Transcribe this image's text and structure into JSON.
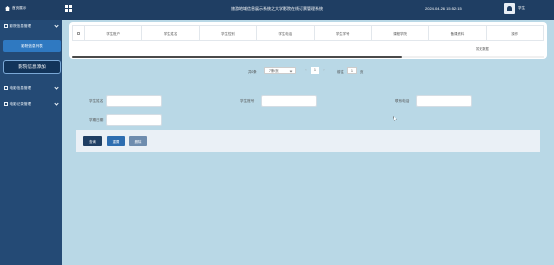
{
  "header": {
    "home_label": "首页展示",
    "title": "旅游地域信息展示系统之大学影院在线订票管理系统",
    "datetime": "2024.04.26 15:52:15",
    "username": "学生"
  },
  "sidebar": {
    "groups": [
      {
        "label": "影院信息管理",
        "expanded": true
      },
      {
        "label": "电影信息管理",
        "expanded": false
      },
      {
        "label": "电影记录管理",
        "expanded": false
      }
    ],
    "sub_items": [
      {
        "label": "影院信息列表"
      },
      {
        "label": "影院信息添加"
      }
    ]
  },
  "table": {
    "columns": [
      "学生账户",
      "学生姓名",
      "学生性别",
      "学生电话",
      "学生学号",
      "课程学院",
      "备课资料",
      "操作"
    ],
    "empty_text": "暂无数据"
  },
  "pagination": {
    "total_label": "共0条",
    "page_size": "7条/页",
    "prev": "‹",
    "current_page": "1",
    "next": "›",
    "goto_label": "前往",
    "goto_value": "1",
    "page_unit": "页"
  },
  "search": {
    "fields": [
      {
        "label": "学生姓名",
        "value": ""
      },
      {
        "label": "学生账号",
        "value": ""
      },
      {
        "label": "联系电话",
        "value": ""
      },
      {
        "label": "学期日期",
        "value": ""
      }
    ]
  },
  "buttons": {
    "query": "查询",
    "reset": "重置",
    "delete": "删除"
  }
}
